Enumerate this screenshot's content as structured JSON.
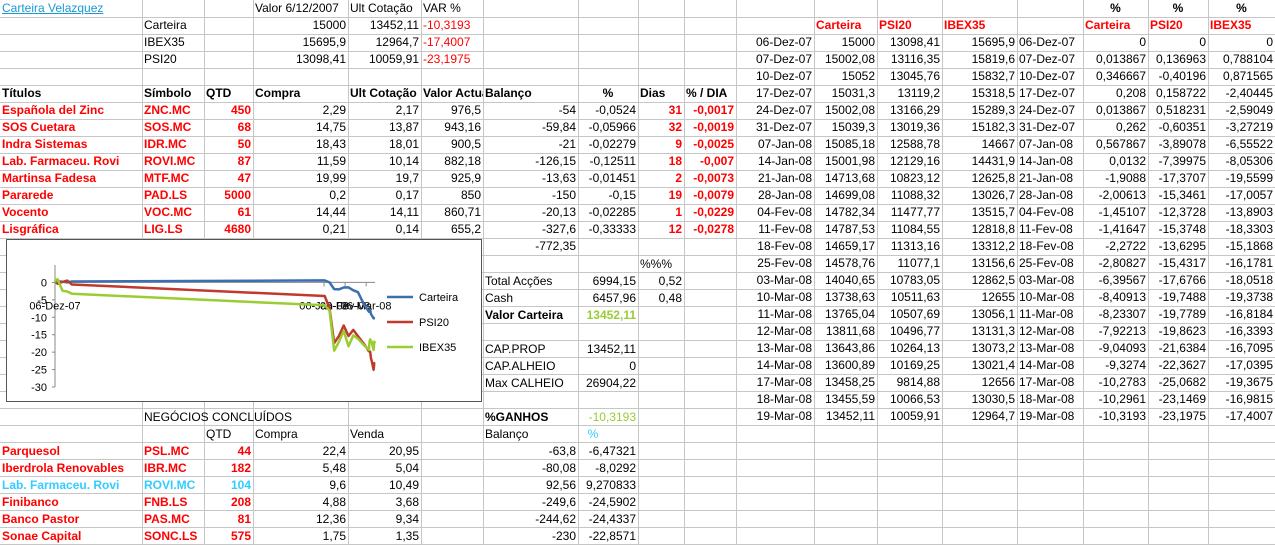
{
  "portfolio": {
    "name": "Carteira Velazquez",
    "hdr": {
      "value_date": "Valor 6/12/2007",
      "ult": "Ult Cotação",
      "var": "VAR %"
    },
    "rows": [
      {
        "label": "Carteira",
        "v1": "15000",
        "v2": "13452,11",
        "var": "-10,3193"
      },
      {
        "label": "IBEX35",
        "v1": "15695,9",
        "v2": "12964,7",
        "var": "-17,4007"
      },
      {
        "label": "PSI20",
        "v1": "13098,41",
        "v2": "10059,91",
        "var": "-23,1975"
      }
    ]
  },
  "holdings": {
    "headers": {
      "titulos": "Títulos",
      "simbolo": "Símbolo",
      "qtd": "QTD",
      "compra": "Compra",
      "ult": "Ult Cotação",
      "valor": "Valor Actual",
      "balanco": "Balanço",
      "pct": "%",
      "dias": "Dias",
      "pdia": "% / DIA"
    },
    "rows": [
      {
        "name": "Española del Zinc",
        "sym": "ZNC.MC",
        "qtd": "450",
        "compra": "2,29",
        "ult": "2,17",
        "valor": "976,5",
        "bal": "-54",
        "pct": "-0,0524",
        "dias": "31",
        "pdia": "-0,0017"
      },
      {
        "name": "SOS Cuetara",
        "sym": "SOS.MC",
        "qtd": "68",
        "compra": "14,75",
        "ult": "13,87",
        "valor": "943,16",
        "bal": "-59,84",
        "pct": "-0,05966",
        "dias": "32",
        "pdia": "-0,0019"
      },
      {
        "name": "Indra Sistemas",
        "sym": "IDR.MC",
        "qtd": "50",
        "compra": "18,43",
        "ult": "18,01",
        "valor": "900,5",
        "bal": "-21",
        "pct": "-0,02279",
        "dias": "9",
        "pdia": "-0,0025"
      },
      {
        "name": "Lab. Farmaceu. Rovi",
        "sym": "ROVI.MC",
        "qtd": "87",
        "compra": "11,59",
        "ult": "10,14",
        "valor": "882,18",
        "bal": "-126,15",
        "pct": "-0,12511",
        "dias": "18",
        "pdia": "-0,007"
      },
      {
        "name": "Martinsa Fadesa",
        "sym": "MTF.MC",
        "qtd": "47",
        "compra": "19,99",
        "ult": "19,7",
        "valor": "925,9",
        "bal": "-13,63",
        "pct": "-0,01451",
        "dias": "2",
        "pdia": "-0,0073"
      },
      {
        "name": "Pararede",
        "sym": "PAD.LS",
        "qtd": "5000",
        "compra": "0,2",
        "ult": "0,17",
        "valor": "850",
        "bal": "-150",
        "pct": "-0,15",
        "dias": "19",
        "pdia": "-0,0079"
      },
      {
        "name": "Vocento",
        "sym": "VOC.MC",
        "qtd": "61",
        "compra": "14,44",
        "ult": "14,11",
        "valor": "860,71",
        "bal": "-20,13",
        "pct": "-0,02285",
        "dias": "1",
        "pdia": "-0,0229"
      },
      {
        "name": "Lisgráfica",
        "sym": "LIG.LS",
        "qtd": "4680",
        "compra": "0,21",
        "ult": "0,14",
        "valor": "655,2",
        "bal": "-327,6",
        "pct": "-0,33333",
        "dias": "12",
        "pdia": "-0,0278"
      }
    ],
    "total_balanco": "-772,35"
  },
  "summary": {
    "pct_hdr": "%%%",
    "total_accoes": {
      "label": "Total Acções",
      "value": "6994,15",
      "pct": "0,52"
    },
    "cash": {
      "label": "Cash",
      "value": "6457,96",
      "pct": "0,48"
    },
    "valor_carteira": {
      "label": "Valor Carteira",
      "value": "13452,11"
    },
    "cap_prop": {
      "label": "CAP.PROP",
      "value": "13452,11"
    },
    "cap_alheio": {
      "label": "CAP.ALHEIO",
      "value": "0"
    },
    "max_calheio": {
      "label": "Max CALHEIO",
      "value": "26904,22"
    },
    "ganhos": {
      "label": "%GANHOS",
      "value": "-10,3193"
    }
  },
  "deals": {
    "title": "NEGÓCIOS CONCLUÍDOS",
    "headers": {
      "qtd": "QTD",
      "compra": "Compra",
      "venda": "Venda",
      "balanco": "Balanço",
      "pct": "%"
    },
    "rows": [
      {
        "name": "Parquesol",
        "sym": "PSL.MC",
        "qtd": "44",
        "compra": "22,4",
        "venda": "20,95",
        "bal": "-63,8",
        "pct": "-6,47321",
        "color": "#ff0000"
      },
      {
        "name": "Iberdrola Renovables",
        "sym": "IBR.MC",
        "qtd": "182",
        "compra": "5,48",
        "venda": "5,04",
        "bal": "-80,08",
        "pct": "-8,0292",
        "color": "#ff0000"
      },
      {
        "name": "Lab. Farmaceu. Rovi",
        "sym": "ROVI.MC",
        "qtd": "104",
        "compra": "9,6",
        "venda": "10,49",
        "bal": "92,56",
        "pct": "9,270833",
        "color": "#33ccff"
      },
      {
        "name": "Finibanco",
        "sym": "FNB.LS",
        "qtd": "208",
        "compra": "4,88",
        "venda": "3,68",
        "bal": "-249,6",
        "pct": "-24,5902",
        "color": "#ff0000"
      },
      {
        "name": "Banco Pastor",
        "sym": "PAS.MC",
        "qtd": "81",
        "compra": "12,36",
        "venda": "9,34",
        "bal": "-244,62",
        "pct": "-24,4337",
        "color": "#ff0000"
      },
      {
        "name": "Sonae Capital",
        "sym": "SONC.LS",
        "qtd": "575",
        "compra": "1,75",
        "venda": "1,35",
        "bal": "-230",
        "pct": "-22,8571",
        "color": "#ff0000"
      }
    ]
  },
  "history": {
    "headers": [
      "Carteira",
      "PSI20",
      "IBEX35"
    ],
    "rows": [
      {
        "date": "06-Dez-07",
        "c": "15000",
        "p": "13098,41",
        "i": "15695,9"
      },
      {
        "date": "07-Dez-07",
        "c": "15002,08",
        "p": "13116,35",
        "i": "15819,6"
      },
      {
        "date": "10-Dez-07",
        "c": "15052",
        "p": "13045,76",
        "i": "15832,7"
      },
      {
        "date": "17-Dez-07",
        "c": "15031,3",
        "p": "13119,2",
        "i": "15318,5"
      },
      {
        "date": "24-Dez-07",
        "c": "15002,08",
        "p": "13166,29",
        "i": "15289,3"
      },
      {
        "date": "31-Dez-07",
        "c": "15039,3",
        "p": "13019,36",
        "i": "15182,3"
      },
      {
        "date": "07-Jan-08",
        "c": "15085,18",
        "p": "12588,78",
        "i": "14667"
      },
      {
        "date": "14-Jan-08",
        "c": "15001,98",
        "p": "12129,16",
        "i": "14431,9"
      },
      {
        "date": "21-Jan-08",
        "c": "14713,68",
        "p": "10823,12",
        "i": "12625,8"
      },
      {
        "date": "28-Jan-08",
        "c": "14699,08",
        "p": "11088,32",
        "i": "13026,7"
      },
      {
        "date": "04-Fev-08",
        "c": "14782,34",
        "p": "11477,77",
        "i": "13515,7"
      },
      {
        "date": "11-Fev-08",
        "c": "14787,53",
        "p": "11084,55",
        "i": "12818,8"
      },
      {
        "date": "18-Fev-08",
        "c": "14659,17",
        "p": "11313,16",
        "i": "13312,2"
      },
      {
        "date": "25-Fev-08",
        "c": "14578,76",
        "p": "11077,1",
        "i": "13156,6"
      },
      {
        "date": "03-Mar-08",
        "c": "14040,65",
        "p": "10783,05",
        "i": "12862,5"
      },
      {
        "date": "10-Mar-08",
        "c": "13738,63",
        "p": "10511,63",
        "i": "12655"
      },
      {
        "date": "11-Mar-08",
        "c": "13765,04",
        "p": "10507,69",
        "i": "13056,1"
      },
      {
        "date": "12-Mar-08",
        "c": "13811,68",
        "p": "10496,77",
        "i": "13131,3"
      },
      {
        "date": "13-Mar-08",
        "c": "13643,86",
        "p": "10264,13",
        "i": "13073,2"
      },
      {
        "date": "14-Mar-08",
        "c": "13600,89",
        "p": "10169,25",
        "i": "13021,4"
      },
      {
        "date": "17-Mar-08",
        "c": "13458,25",
        "p": "9814,88",
        "i": "12656"
      },
      {
        "date": "18-Mar-08",
        "c": "13455,59",
        "p": "10066,53",
        "i": "13030,5"
      },
      {
        "date": "19-Mar-08",
        "c": "13452,11",
        "p": "10059,91",
        "i": "12964,7"
      }
    ]
  },
  "pct_history": {
    "headers": [
      "%",
      "%",
      "%"
    ],
    "series_headers": [
      "Carteira",
      "PSI20",
      "IBEX35"
    ],
    "rows": [
      {
        "date": "06-Dez-07",
        "c": "0",
        "p": "0",
        "i": "0"
      },
      {
        "date": "07-Dez-07",
        "c": "0,013867",
        "p": "0,136963",
        "i": "0,788104"
      },
      {
        "date": "10-Dez-07",
        "c": "0,346667",
        "p": "-0,40196",
        "i": "0,871565"
      },
      {
        "date": "17-Dez-07",
        "c": "0,208",
        "p": "0,158722",
        "i": "-2,40445"
      },
      {
        "date": "24-Dez-07",
        "c": "0,013867",
        "p": "0,518231",
        "i": "-2,59049"
      },
      {
        "date": "31-Dez-07",
        "c": "0,262",
        "p": "-0,60351",
        "i": "-3,27219"
      },
      {
        "date": "07-Jan-08",
        "c": "0,567867",
        "p": "-3,89078",
        "i": "-6,55522"
      },
      {
        "date": "14-Jan-08",
        "c": "0,0132",
        "p": "-7,39975",
        "i": "-8,05306"
      },
      {
        "date": "21-Jan-08",
        "c": "-1,9088",
        "p": "-17,3707",
        "i": "-19,5599"
      },
      {
        "date": "28-Jan-08",
        "c": "-2,00613",
        "p": "-15,3461",
        "i": "-17,0057"
      },
      {
        "date": "04-Fev-08",
        "c": "-1,45107",
        "p": "-12,3728",
        "i": "-13,8903"
      },
      {
        "date": "11-Fev-08",
        "c": "-1,41647",
        "p": "-15,3748",
        "i": "-18,3303"
      },
      {
        "date": "18-Fev-08",
        "c": "-2,2722",
        "p": "-13,6295",
        "i": "-15,1868"
      },
      {
        "date": "25-Fev-08",
        "c": "-2,80827",
        "p": "-15,4317",
        "i": "-16,1781"
      },
      {
        "date": "03-Mar-08",
        "c": "-6,39567",
        "p": "-17,6766",
        "i": "-18,0518"
      },
      {
        "date": "10-Mar-08",
        "c": "-8,40913",
        "p": "-19,7488",
        "i": "-19,3738"
      },
      {
        "date": "11-Mar-08",
        "c": "-8,23307",
        "p": "-19,7789",
        "i": "-16,8184"
      },
      {
        "date": "12-Mar-08",
        "c": "-7,92213",
        "p": "-19,8623",
        "i": "-16,3393"
      },
      {
        "date": "13-Mar-08",
        "c": "-9,04093",
        "p": "-21,6384",
        "i": "-16,7095"
      },
      {
        "date": "14-Mar-08",
        "c": "-9,3274",
        "p": "-22,3627",
        "i": "-17,0395"
      },
      {
        "date": "17-Mar-08",
        "c": "-10,2783",
        "p": "-25,0682",
        "i": "-19,3675"
      },
      {
        "date": "18-Mar-08",
        "c": "-10,2961",
        "p": "-23,1469",
        "i": "-16,9815"
      },
      {
        "date": "19-Mar-08",
        "c": "-10,3193",
        "p": "-23,1975",
        "i": "-17,4007"
      }
    ]
  },
  "chart_data": {
    "type": "line",
    "x": [
      "06-Dez-07",
      "07-Dez-07",
      "10-Dez-07",
      "17-Dez-07",
      "24-Dez-07",
      "31-Dez-07",
      "07-Jan-08",
      "14-Jan-08",
      "21-Jan-08",
      "28-Jan-08",
      "04-Fev-08",
      "11-Fev-08",
      "18-Fev-08",
      "25-Fev-08",
      "03-Mar-08",
      "10-Mar-08",
      "11-Mar-08",
      "12-Mar-08",
      "13-Mar-08",
      "14-Mar-08",
      "17-Mar-08",
      "18-Mar-08",
      "19-Mar-08"
    ],
    "x_ticks": [
      "06-Dez-07",
      "06-Jan-08",
      "06-Fev-08",
      "06-Mar-08"
    ],
    "series": [
      {
        "name": "Carteira",
        "color": "#3d6eb0",
        "values": [
          0,
          0.01,
          0.35,
          0.21,
          0.01,
          0.26,
          0.57,
          0.01,
          -1.91,
          -2.01,
          -1.45,
          -1.42,
          -2.27,
          -2.81,
          -6.4,
          -8.41,
          -8.23,
          -7.92,
          -9.04,
          -9.33,
          -10.28,
          -10.3,
          -10.32
        ]
      },
      {
        "name": "PSI20",
        "color": "#c0392b",
        "values": [
          0,
          0.14,
          -0.4,
          0.16,
          0.52,
          -0.6,
          -3.89,
          -7.4,
          -17.37,
          -15.35,
          -12.37,
          -15.37,
          -13.63,
          -15.43,
          -17.68,
          -19.75,
          -19.78,
          -19.86,
          -21.64,
          -22.36,
          -25.07,
          -23.15,
          -23.2
        ]
      },
      {
        "name": "IBEX35",
        "color": "#9acd32",
        "values": [
          0,
          0.79,
          0.87,
          -2.4,
          -2.59,
          -3.27,
          -6.56,
          -8.05,
          -19.56,
          -17.01,
          -13.89,
          -18.33,
          -15.19,
          -16.18,
          -18.05,
          -19.37,
          -16.82,
          -16.34,
          -16.71,
          -17.04,
          -19.37,
          -16.98,
          -17.4
        ]
      }
    ],
    "y_ticks": [
      "0",
      "-5",
      "-10",
      "-15",
      "-20",
      "-25",
      "-30"
    ],
    "ylim": [
      -30,
      5
    ],
    "legend": "right",
    "grid": false
  }
}
